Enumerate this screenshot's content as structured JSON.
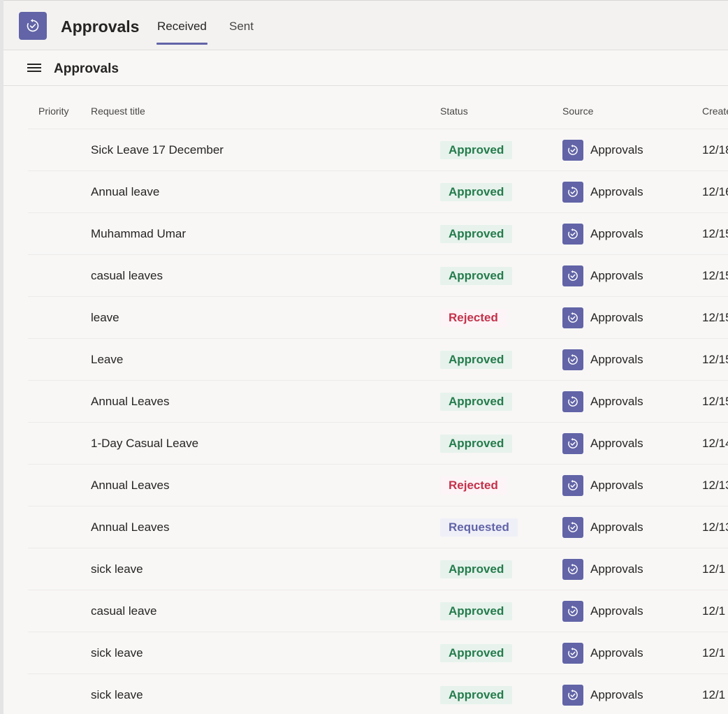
{
  "header": {
    "app_name": "Approvals",
    "app_icon": "approvals-icon",
    "accent_color": "#6264a7",
    "tabs": [
      {
        "label": "Received",
        "active": true
      },
      {
        "label": "Sent",
        "active": false
      }
    ]
  },
  "subheader": {
    "menu_icon": "hamburger-menu-icon",
    "title": "Approvals"
  },
  "table": {
    "columns": {
      "priority": "Priority",
      "title": "Request title",
      "status": "Status",
      "source": "Source",
      "created": "Create"
    },
    "status_colors": {
      "Approved": "#237b4b",
      "Rejected": "#c4314b",
      "Requested": "#6264a7"
    },
    "rows": [
      {
        "title": "Sick Leave 17 December",
        "status": "Approved",
        "source": "Approvals",
        "created": "12/18"
      },
      {
        "title": "Annual leave",
        "status": "Approved",
        "source": "Approvals",
        "created": "12/16"
      },
      {
        "title": "Muhammad Umar",
        "status": "Approved",
        "source": "Approvals",
        "created": "12/15"
      },
      {
        "title": "casual leaves",
        "status": "Approved",
        "source": "Approvals",
        "created": "12/15"
      },
      {
        "title": "leave",
        "status": "Rejected",
        "source": "Approvals",
        "created": "12/15"
      },
      {
        "title": "Leave",
        "status": "Approved",
        "source": "Approvals",
        "created": "12/15"
      },
      {
        "title": "Annual Leaves",
        "status": "Approved",
        "source": "Approvals",
        "created": "12/15"
      },
      {
        "title": "1-Day Casual Leave",
        "status": "Approved",
        "source": "Approvals",
        "created": "12/14"
      },
      {
        "title": "Annual Leaves",
        "status": "Rejected",
        "source": "Approvals",
        "created": "12/13"
      },
      {
        "title": "Annual Leaves",
        "status": "Requested",
        "source": "Approvals",
        "created": "12/13"
      },
      {
        "title": "sick leave",
        "status": "Approved",
        "source": "Approvals",
        "created": "12/1"
      },
      {
        "title": "casual leave",
        "status": "Approved",
        "source": "Approvals",
        "created": "12/1"
      },
      {
        "title": "sick leave",
        "status": "Approved",
        "source": "Approvals",
        "created": "12/1"
      },
      {
        "title": "sick leave",
        "status": "Approved",
        "source": "Approvals",
        "created": "12/1"
      }
    ]
  }
}
